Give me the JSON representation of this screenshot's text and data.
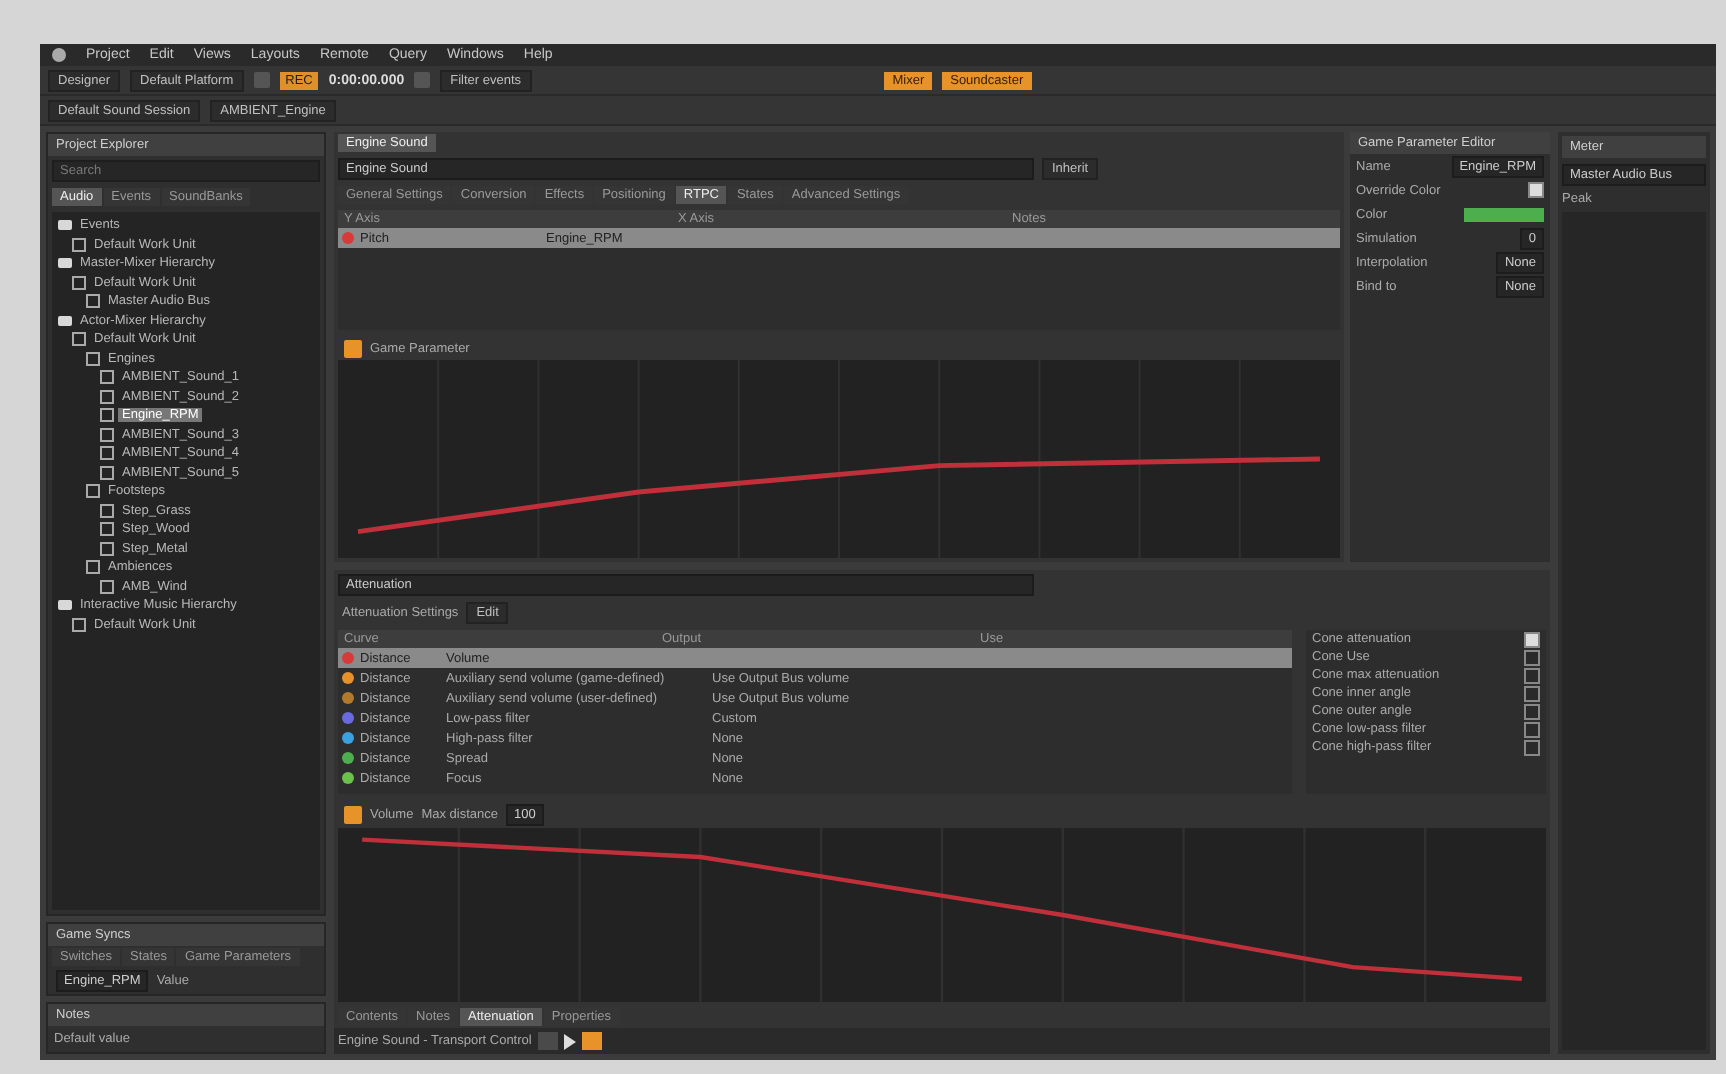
{
  "menu": [
    "Project",
    "Edit",
    "Views",
    "Layouts",
    "Remote",
    "Query",
    "Windows",
    "Help"
  ],
  "toolbar": {
    "layout": "Designer",
    "platform": "Default Platform",
    "record": "REC",
    "time": "0:00:00.000",
    "filter": "Filter events",
    "tags": [
      "Mixer",
      "Soundcaster"
    ],
    "session": "Default Sound Session",
    "object": "AMBIENT_Engine"
  },
  "explorer": {
    "title": "Project Explorer",
    "search_placeholder": "Search",
    "tabs": [
      {
        "label": "Audio",
        "selected": true
      },
      {
        "label": "Events",
        "selected": false
      },
      {
        "label": "SoundBanks",
        "selected": false
      }
    ],
    "tree": [
      {
        "label": "Events",
        "children": [
          {
            "label": "Default Work Unit"
          }
        ]
      },
      {
        "label": "Master-Mixer Hierarchy",
        "children": [
          {
            "label": "Default Work Unit",
            "children": [
              {
                "label": "Master Audio Bus"
              }
            ]
          }
        ]
      },
      {
        "label": "Actor-Mixer Hierarchy",
        "children": [
          {
            "label": "Default Work Unit",
            "children": [
              {
                "label": "Engines",
                "children": [
                  {
                    "label": "AMBIENT_Sound_1"
                  },
                  {
                    "label": "AMBIENT_Sound_2"
                  },
                  {
                    "label": "Engine_RPM",
                    "selected": true
                  },
                  {
                    "label": "AMBIENT_Sound_3"
                  },
                  {
                    "label": "AMBIENT_Sound_4"
                  },
                  {
                    "label": "AMBIENT_Sound_5"
                  }
                ]
              },
              {
                "label": "Footsteps",
                "children": [
                  {
                    "label": "Step_Grass"
                  },
                  {
                    "label": "Step_Wood"
                  },
                  {
                    "label": "Step_Metal"
                  }
                ]
              },
              {
                "label": "Ambiences",
                "children": [
                  {
                    "label": "AMB_Wind"
                  }
                ]
              }
            ]
          }
        ]
      },
      {
        "label": "Interactive Music Hierarchy",
        "children": [
          {
            "label": "Default Work Unit"
          }
        ]
      }
    ]
  },
  "states_panel": {
    "title": "Game Syncs",
    "tabs": [
      "Switches",
      "States",
      "Game Parameters"
    ],
    "field": "Engine_RPM",
    "row": "Value"
  },
  "notes_panel": {
    "title": "Notes",
    "text": "Default value"
  },
  "editor": {
    "tab": "Engine Sound",
    "name": "Engine Sound",
    "options": "Inherit",
    "prop_tabs": [
      {
        "label": "General Settings",
        "selected": false
      },
      {
        "label": "Conversion",
        "selected": false
      },
      {
        "label": "Effects",
        "selected": false
      },
      {
        "label": "Positioning",
        "selected": false
      },
      {
        "label": "RTPC",
        "selected": true
      },
      {
        "label": "States",
        "selected": false
      },
      {
        "label": "Advanced Settings",
        "selected": false
      }
    ],
    "columns": [
      "Y Axis",
      "X Axis",
      "Notes"
    ],
    "row": {
      "yaxis": "Pitch",
      "xaxis": "Engine_RPM"
    },
    "graph_title": "Game Parameter",
    "inspector_title": "Game Parameter Editor",
    "inspector": [
      {
        "label": "Name",
        "value": "Engine_RPM",
        "kind": "text"
      },
      {
        "label": "Override Color",
        "kind": "check",
        "checked": true
      },
      {
        "label": "Color",
        "kind": "swatch",
        "color": "#4cae4c"
      },
      {
        "label": "Simulation",
        "value": "0",
        "kind": "text"
      },
      {
        "label": "Interpolation",
        "value": "None",
        "kind": "text"
      },
      {
        "label": "Bind to",
        "value": "None",
        "kind": "text"
      }
    ]
  },
  "rtpc": {
    "title": "Attenuation",
    "header": "Attenuation Settings",
    "edit": "Edit",
    "columns": [
      "Curve",
      "Output",
      "Use"
    ],
    "rows": [
      {
        "color": "#d83a3a",
        "type": "Distance",
        "output": "Volume",
        "selected": true
      },
      {
        "color": "#e8902a",
        "type": "Distance",
        "output": "Auxiliary send volume (game-defined)",
        "use": "Use Output Bus volume",
        "selected": false
      },
      {
        "color": "#b07a2a",
        "type": "Distance",
        "output": "Auxiliary send volume (user-defined)",
        "use": "Use Output Bus volume",
        "selected": false
      },
      {
        "color": "#6a6ae0",
        "type": "Distance",
        "output": "Low-pass filter",
        "use": "Custom",
        "selected": false
      },
      {
        "color": "#3aa0e0",
        "type": "Distance",
        "output": "High-pass filter",
        "use": "None",
        "selected": false
      },
      {
        "color": "#4cae4c",
        "type": "Distance",
        "output": "Spread",
        "use": "None",
        "selected": false
      },
      {
        "color": "#6cc04c",
        "type": "Distance",
        "output": "Focus",
        "use": "None",
        "selected": false
      }
    ],
    "props": [
      {
        "label": "Cone attenuation",
        "checked": true
      },
      {
        "label": "Cone Use",
        "checked": false
      },
      {
        "label": "Cone max attenuation",
        "checked": false
      },
      {
        "label": "Cone inner angle",
        "checked": false
      },
      {
        "label": "Cone outer angle",
        "checked": false
      },
      {
        "label": "Cone low-pass filter",
        "checked": false
      },
      {
        "label": "Cone high-pass filter",
        "checked": false
      }
    ],
    "graph_title": "Volume",
    "max_distance": "Max distance",
    "max_value": "100",
    "bottom_tabs": [
      {
        "label": "Contents",
        "selected": false
      },
      {
        "label": "Notes",
        "selected": false
      },
      {
        "label": "Attenuation",
        "selected": true
      },
      {
        "label": "Properties",
        "selected": false
      }
    ],
    "transport_title": "Engine Sound - Transport Control"
  },
  "meter": {
    "title": "Meter",
    "source": "Master Audio Bus",
    "mode": "Peak"
  }
}
